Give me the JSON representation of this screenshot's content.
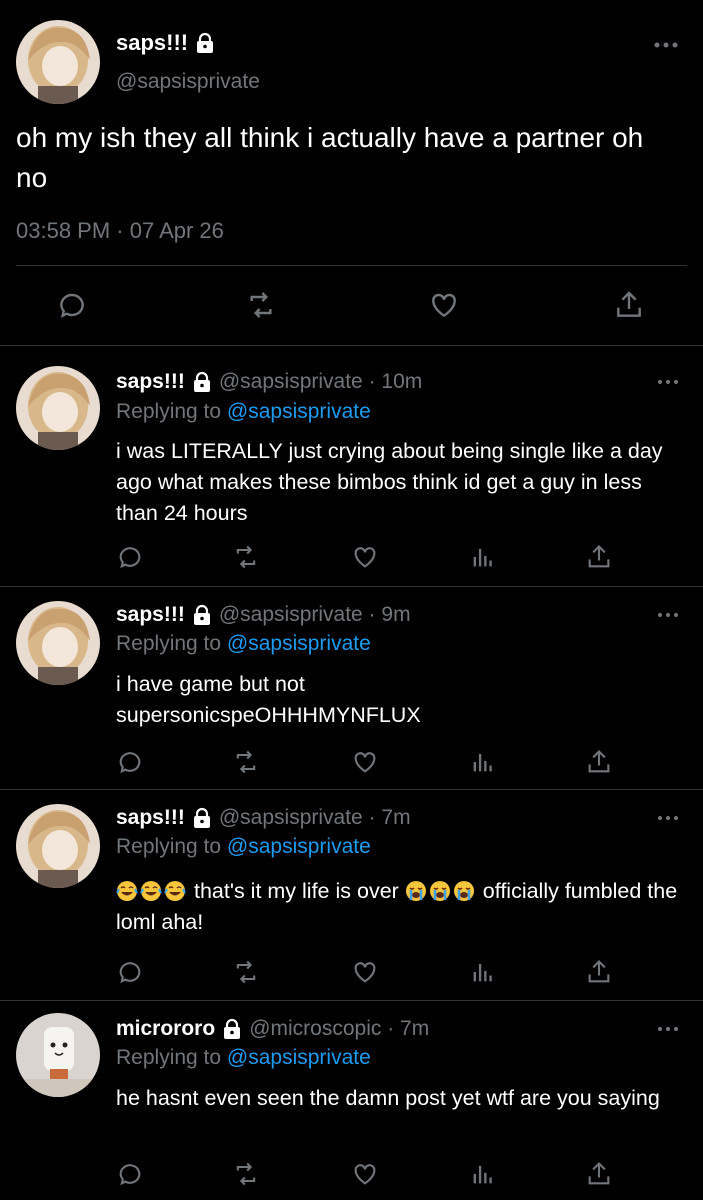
{
  "main_tweet": {
    "display_name": "saps!!!",
    "handle": "@sapsisprivate",
    "text": "oh my ish they all think i actually have a partner oh no",
    "timestamp": "03:58 PM · 07 Apr 26"
  },
  "replies": [
    {
      "display_name": "saps!!!",
      "handle": "@sapsisprivate · 10m",
      "replying_prefix": "Replying to",
      "replying_to": "@sapsisprivate",
      "text": "i was LITERALLY just crying about being single like a day ago what makes these bimbos think id get a guy in less than 24 hours"
    },
    {
      "display_name": "saps!!!",
      "handle": "@sapsisprivate · 9m",
      "replying_prefix": "Replying to",
      "replying_to": "@sapsisprivate",
      "text": "i have game but not supersonicspeOHHHMYNFLUX"
    },
    {
      "display_name": "saps!!!",
      "handle": "@sapsisprivate · 7m",
      "replying_prefix": "Replying to",
      "replying_to": "@sapsisprivate",
      "text_part1": "that's it my life is over",
      "text_part2": "officially fumbled the loml aha!"
    },
    {
      "display_name": "microroro",
      "handle": "@microscopic · 7m",
      "replying_prefix": "Replying to",
      "replying_to": "@sapsisprivate",
      "text": "he hasnt even seen the damn post yet wtf are you saying"
    }
  ],
  "icons": {
    "lock": "lock-icon",
    "more": "more-icon",
    "reply": "reply-icon",
    "retweet": "retweet-icon",
    "like": "like-icon",
    "views": "views-icon",
    "share": "share-icon",
    "laugh_emoji": "face-with-tears-of-joy",
    "cry_emoji": "loudly-crying-face"
  },
  "colors": {
    "background": "#000000",
    "text": "#e7e9ea",
    "muted": "#71767b",
    "link": "#1d9bf0",
    "divider": "#2f3336"
  }
}
